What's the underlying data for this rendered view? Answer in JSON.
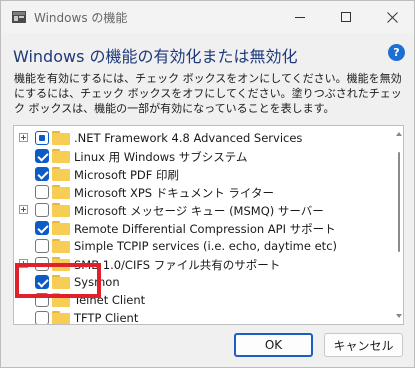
{
  "window": {
    "title": "Windows の機能",
    "app_icon": "windows-features-icon"
  },
  "heading": "Windows の機能の有効化または無効化",
  "help": "?",
  "description": "機能を有効にするには、チェック ボックスをオンにしてください。機能を無効にするには、チェック ボックスをオフにしてください。塗りつぶされたチェック ボックスは、機能の一部が有効になっていることを表します。",
  "features": [
    {
      "label": ".NET Framework 4.8 Advanced Services",
      "state": "partial",
      "expandable": true
    },
    {
      "label": "Linux 用 Windows サブシステム",
      "state": "checked",
      "expandable": false
    },
    {
      "label": "Microsoft PDF 印刷",
      "state": "checked",
      "expandable": false
    },
    {
      "label": "Microsoft XPS ドキュメント ライター",
      "state": "unchecked",
      "expandable": false
    },
    {
      "label": "Microsoft メッセージ キュー (MSMQ) サーバー",
      "state": "unchecked",
      "expandable": true
    },
    {
      "label": "Remote Differential Compression API サポート",
      "state": "checked",
      "expandable": false
    },
    {
      "label": "Simple TCPIP services (i.e. echo, daytime etc)",
      "state": "unchecked",
      "expandable": false
    },
    {
      "label": "SMB 1.0/CIFS ファイル共有のサポート",
      "state": "unchecked",
      "expandable": true
    },
    {
      "label": "Sysmon",
      "state": "checked",
      "expandable": false
    },
    {
      "label": "Telnet Client",
      "state": "unchecked",
      "expandable": false
    },
    {
      "label": "TFTP Client",
      "state": "unchecked",
      "expandable": false
    }
  ],
  "buttons": {
    "ok": "OK",
    "cancel": "キャンセル"
  },
  "colors": {
    "accent": "#0b5cc7",
    "highlight": "#e0202a",
    "folder": "#f8cd55"
  }
}
